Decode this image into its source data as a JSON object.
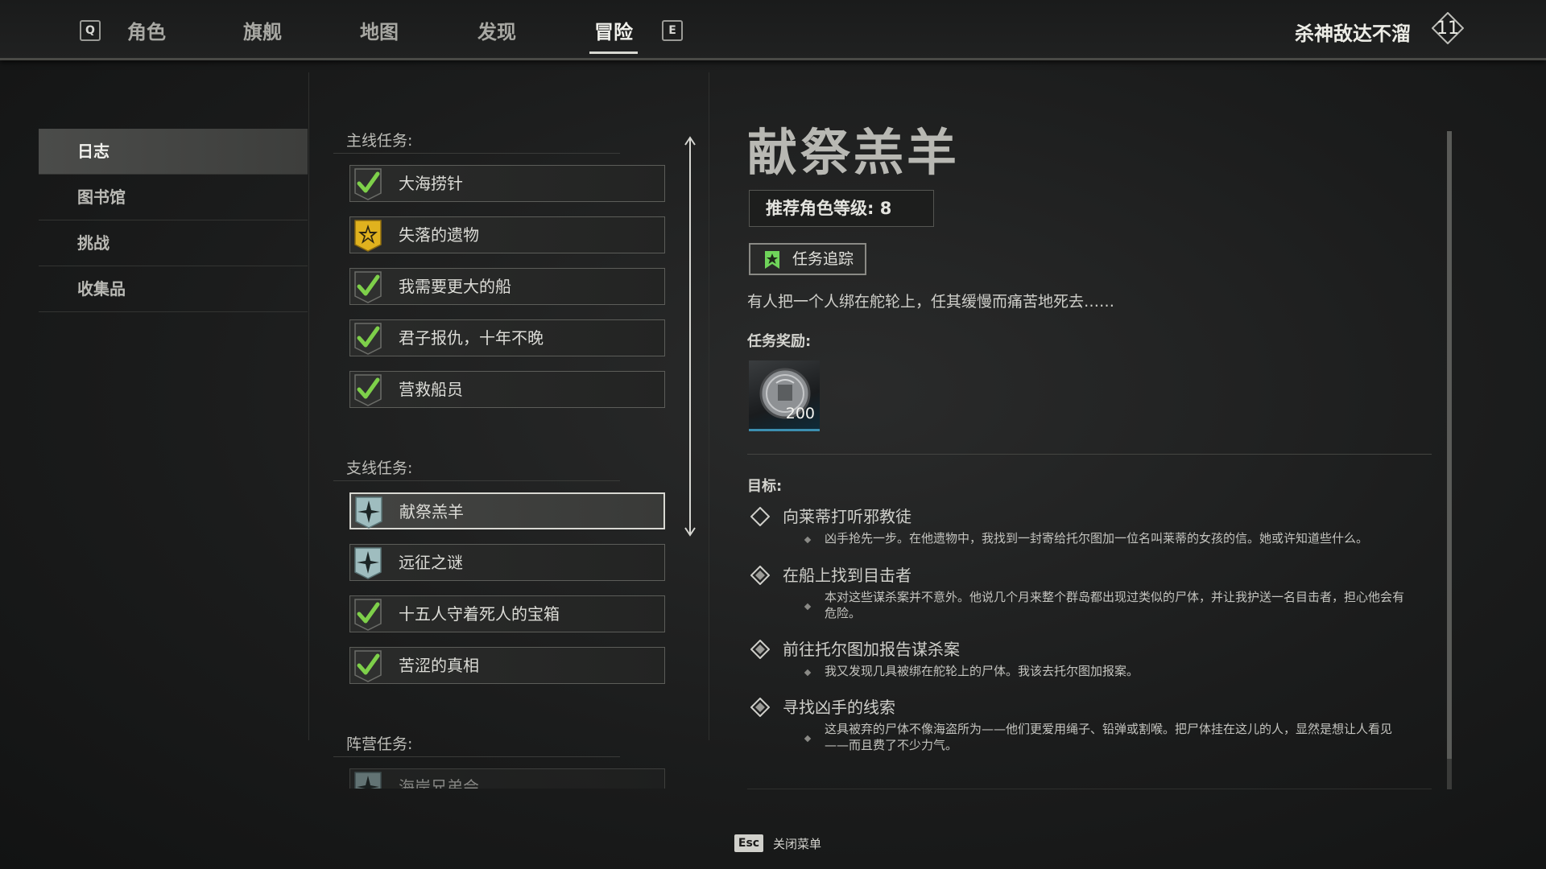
{
  "nav": {
    "left_key": "Q",
    "right_key": "E",
    "tabs": [
      {
        "label": "角色"
      },
      {
        "label": "旗舰"
      },
      {
        "label": "地图"
      },
      {
        "label": "发现"
      },
      {
        "label": "冒险",
        "active": true
      }
    ],
    "player_name": "杀神敌达不溜",
    "player_level": "11"
  },
  "sidebar": {
    "items": [
      {
        "label": "日志",
        "active": true
      },
      {
        "label": "图书馆"
      },
      {
        "label": "挑战"
      },
      {
        "label": "收集品"
      }
    ]
  },
  "quests": {
    "main_label": "主线任务:",
    "main": [
      {
        "label": "大海捞针",
        "icon": "check-icon"
      },
      {
        "label": "失落的遗物",
        "icon": "gold-star-icon"
      },
      {
        "label": "我需要更大的船",
        "icon": "check-icon"
      },
      {
        "label": "君子报仇，十年不晚",
        "icon": "check-icon"
      },
      {
        "label": "营救船员",
        "icon": "check-icon"
      }
    ],
    "side_label": "支线任务:",
    "side": [
      {
        "label": "献祭羔羊",
        "icon": "compass-star-icon",
        "selected": true
      },
      {
        "label": "远征之谜",
        "icon": "compass-star-icon"
      },
      {
        "label": "十五人守着死人的宝箱",
        "icon": "check-icon"
      },
      {
        "label": "苦涩的真相",
        "icon": "check-icon"
      }
    ],
    "faction_label": "阵营任务:",
    "faction": [
      {
        "label": "海岸兄弟会",
        "icon": "compass-star-icon"
      }
    ]
  },
  "detail": {
    "title": "献祭羔羊",
    "recommended_level": "推荐角色等级:  8",
    "track_label": "任务追踪",
    "description": "有人把一个人绑在舵轮上，任其缓慢而痛苦地死去……",
    "reward_label": "任务奖励:",
    "reward_amount": "200",
    "objectives_label": "目标:",
    "objectives": [
      {
        "title": "向莱蒂打听邪教徒",
        "desc": "凶手抢先一步。在他遗物中，我找到一封寄给托尔图加一位名叫莱蒂的女孩的信。她或许知道些什么。",
        "done": false
      },
      {
        "title": "在船上找到目击者",
        "desc": "本对这些谋杀案并不意外。他说几个月来整个群岛都出现过类似的尸体，并让我护送一名目击者，担心他会有危险。",
        "done": true
      },
      {
        "title": "前往托尔图加报告谋杀案",
        "desc": "我又发现几具被绑在舵轮上的尸体。我该去托尔图加报案。",
        "done": true
      },
      {
        "title": "寻找凶手的线索",
        "desc": "这具被弃的尸体不像海盗所为——他们更爱用绳子、铅弹或割喉。把尸体挂在这儿的人，显然是想让人看见——而且费了不少力气。",
        "done": true
      }
    ]
  },
  "footer": {
    "key": "Esc",
    "label": "关闭菜单"
  },
  "colors": {
    "check_green": "#7ed04a",
    "gold": "#e0b21e",
    "teal_badge": "#9fbdbf",
    "reward_accent": "#3c8fb0"
  }
}
